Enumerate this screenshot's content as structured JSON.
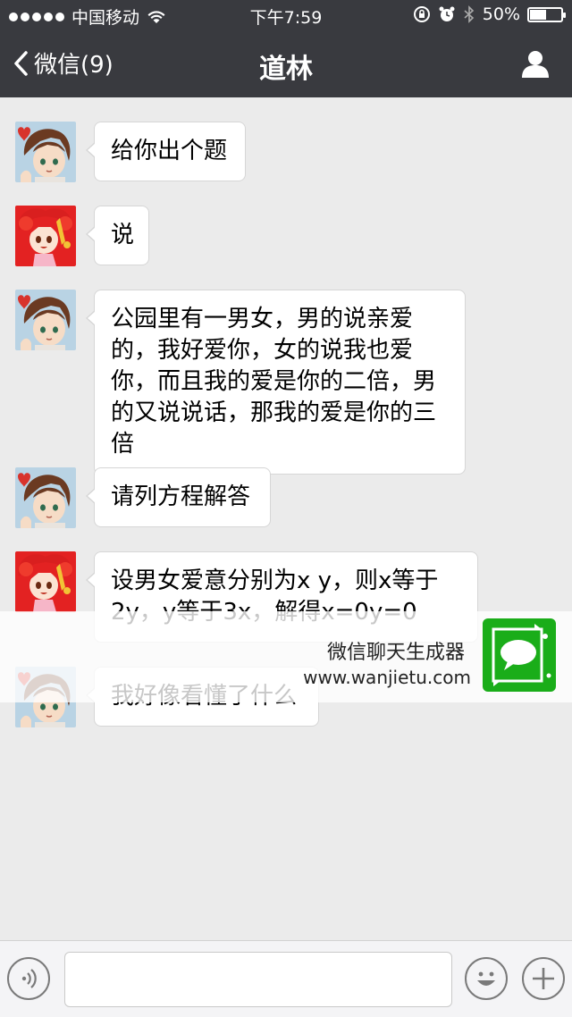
{
  "status_bar": {
    "carrier": "中国移动",
    "time": "下午7:59",
    "battery": "50%",
    "battery_level": 0.5
  },
  "nav": {
    "back_label": "微信(9)",
    "title": "道林"
  },
  "messages": [
    {
      "sender": "boy",
      "text": "给你出个题"
    },
    {
      "sender": "girl",
      "text": "说"
    },
    {
      "sender": "boy",
      "text": "公园里有一男女，男的说亲爱的，我好爱你，女的说我也爱你，而且我的爱是你的二倍，男的又说说话，那我的爱是你的三倍"
    },
    {
      "sender": "boy",
      "text": "请列方程解答"
    },
    {
      "sender": "girl",
      "text": "设男女爱意分别为x y，则x等于2y，y等于3x，解得x=0y=0"
    },
    {
      "sender": "boy",
      "text": "我好像看懂了什么"
    }
  ],
  "watermark": {
    "title": "微信聊天生成器",
    "url": "www.wanjietu.com"
  },
  "colors": {
    "header_bg": "#393a3f",
    "chat_bg": "#ebebeb",
    "brand_green": "#1aad19"
  },
  "icons": {
    "back": "chevron-left-icon",
    "profile": "person-icon",
    "voice": "voice-icon",
    "emoji": "emoji-icon",
    "plus": "plus-icon"
  }
}
